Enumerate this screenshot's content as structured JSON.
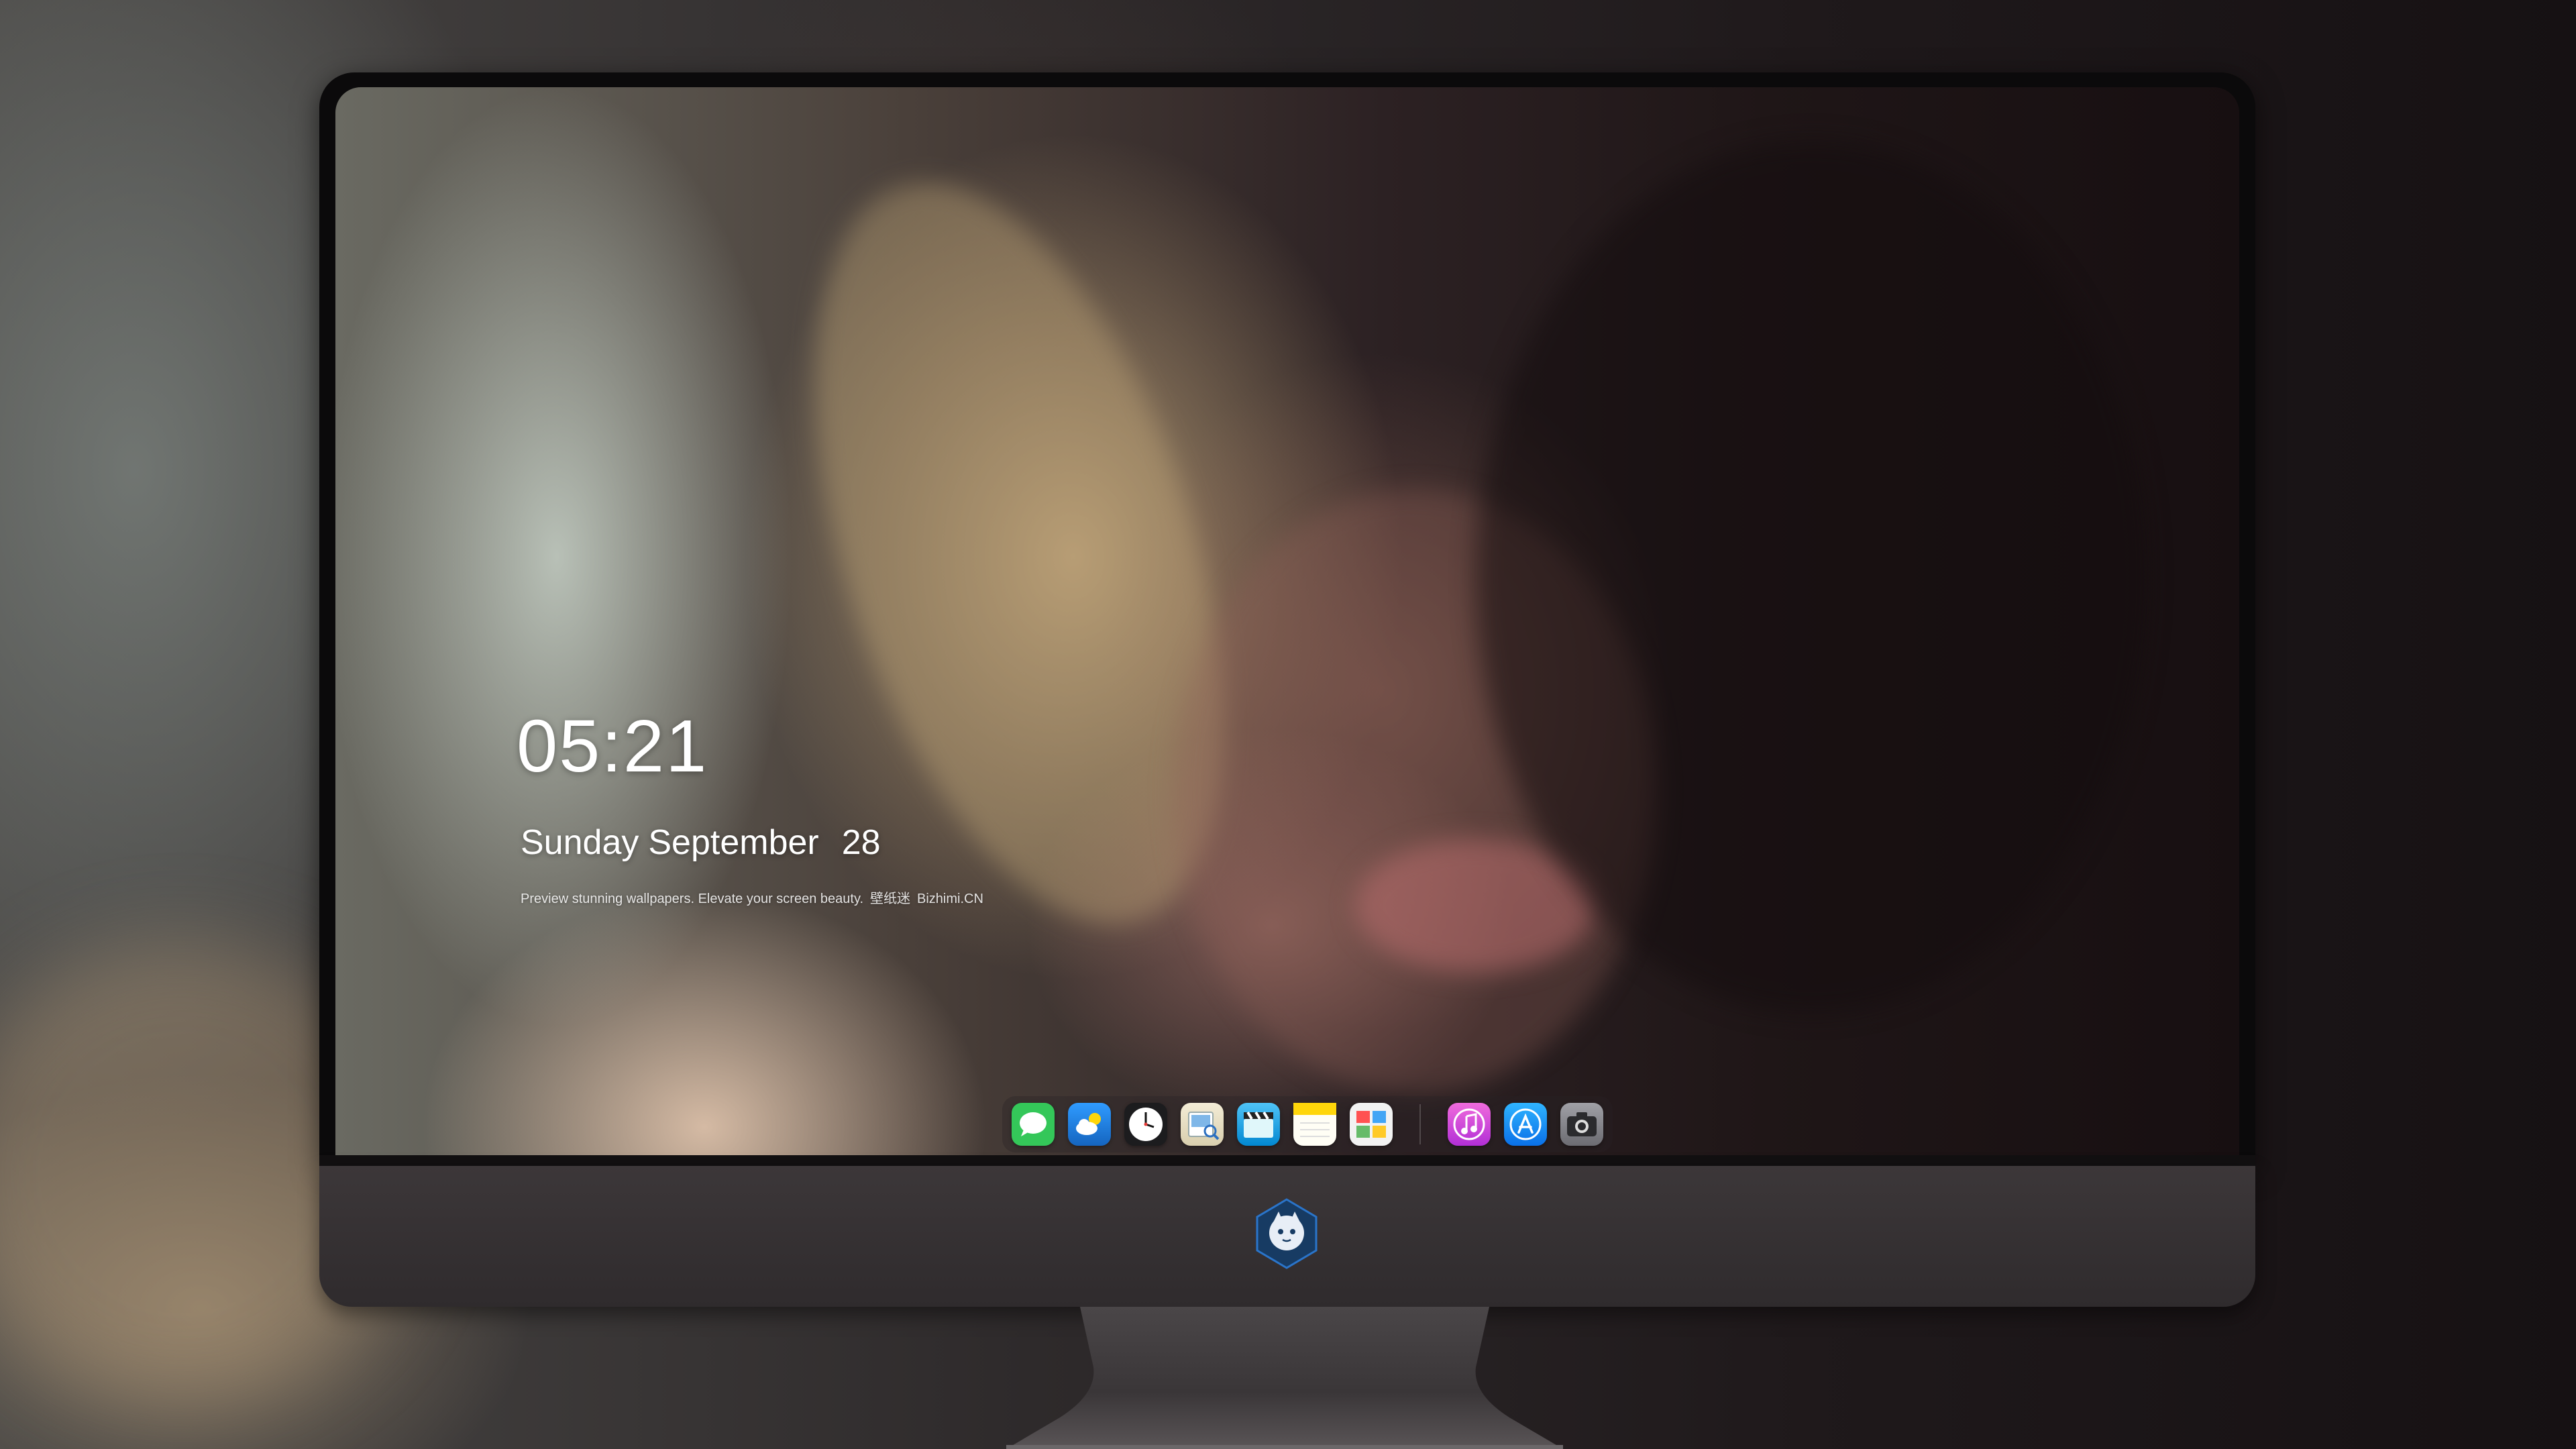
{
  "lockscreen": {
    "time": "05:21",
    "weekday": "Sunday",
    "month": "September",
    "day": "28",
    "tagline_main": "Preview stunning wallpapers. Elevate your screen beauty.",
    "tagline_cn": "壁纸迷",
    "tagline_brand": "Bizhimi.CN"
  },
  "dock": {
    "apps": [
      {
        "name": "Messages",
        "icon": "messages-icon",
        "color": "#34c759"
      },
      {
        "name": "Weather",
        "icon": "weather-icon",
        "color": "#1e88e5"
      },
      {
        "name": "Clock",
        "icon": "clock-icon",
        "color": "#1c1c1e"
      },
      {
        "name": "Preview",
        "icon": "preview-icon",
        "color": "#e8e0c8"
      },
      {
        "name": "Clips",
        "icon": "clips-icon",
        "color": "#1ea8e0"
      },
      {
        "name": "Notes",
        "icon": "notes-icon",
        "color": "#ffd60a"
      },
      {
        "name": "Photo Booth",
        "icon": "photo-booth-icon",
        "color": "#e8e8e8"
      },
      {
        "name": "iTunes",
        "icon": "itunes-icon",
        "color": "#e23dcf"
      },
      {
        "name": "App Store",
        "icon": "app-store-icon",
        "color": "#1a8cff"
      },
      {
        "name": "Camera",
        "icon": "camera-icon",
        "color": "#8e8e93"
      }
    ]
  },
  "colors": {
    "accent_text": "#ffffff",
    "bezel": "#0b0a0b",
    "chin": "#3c3739"
  }
}
